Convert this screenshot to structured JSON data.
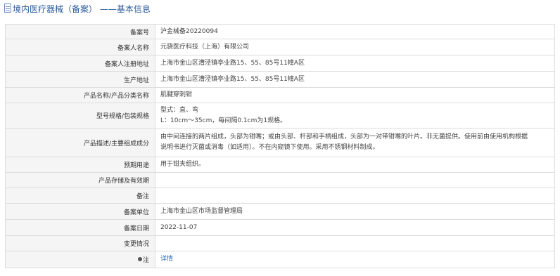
{
  "header": {
    "title": "境内医疗器械（备案） ——基本信息"
  },
  "rows": {
    "record_no": {
      "label": "备案号",
      "value": "沪金械备20220094"
    },
    "registrant": {
      "label": "备案人名称",
      "value": "元骁医疗科技（上海）有限公司"
    },
    "reg_address": {
      "label": "备案人注册地址",
      "value": "上海市金山区漕泾镇亭业路15、55、85号11幢A区"
    },
    "prod_address": {
      "label": "生产地址",
      "value": "上海市金山区漕泾镇亭业路15、55、85号11幢A区"
    },
    "product_name": {
      "label": "产品名称/产品分类名称",
      "value": "肌腱穿刺钳"
    },
    "model_spec": {
      "label": "型号规格/包装规格",
      "line1": "型式：直、弯",
      "line2": "L：10cm～35cm，每间隔0.1cm为1规格。"
    },
    "description": {
      "label": "产品描述/主要组成成分",
      "line1": "由中间连接的两片组成，头部为钳嘴；或由头部、杆部和手柄组成，头部为一对带钳嘴的叶片。非无菌提供。使用前由使用机构根据",
      "line2": "说明书进行灭菌或消毒（如适用）。不在内窥镜下使用。采用不锈钢材料制成。"
    },
    "intended_use": {
      "label": "预期用途",
      "value": "用于钳夹组织。"
    },
    "storage": {
      "label": "产品存储及有效期",
      "value": ""
    },
    "remarks": {
      "label": "备注",
      "value": ""
    },
    "record_unit": {
      "label": "备案单位",
      "value": "上海市金山区市场监督管理局"
    },
    "record_date": {
      "label": "备案日期",
      "value": "2022-11-07"
    },
    "change": {
      "label": "变更情况",
      "value": ""
    },
    "note": {
      "label": "注",
      "link": "详情"
    }
  }
}
